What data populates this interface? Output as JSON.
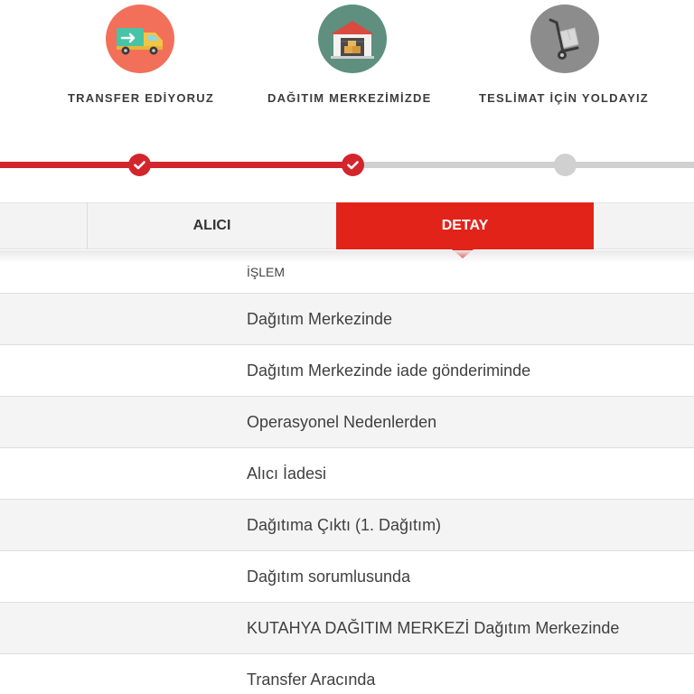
{
  "steps": [
    {
      "label": "TRANSFER EDİYORUZ",
      "icon": "truck-icon",
      "color": "#f2705a",
      "status": "done"
    },
    {
      "label": "DAĞITIM MERKEZİMİZDE",
      "icon": "warehouse-icon",
      "color": "#5e8f7f",
      "status": "done"
    },
    {
      "label": "TESLİMAT İÇİN YOLDAYIZ",
      "icon": "hand-truck-icon",
      "color": "#8c8c8c",
      "status": "pending"
    }
  ],
  "progress": {
    "completed_steps": 2,
    "total_steps": 3,
    "done_color": "#d3252c",
    "pending_color": "#d0d0d0"
  },
  "tabs": {
    "alici": "ALICI",
    "detay": "DETAY",
    "active": "DETAY",
    "active_color": "#e2231a"
  },
  "table": {
    "header": "İŞLEM",
    "rows": [
      "Dağıtım Merkezinde",
      "Dağıtım Merkezinde iade gönderiminde",
      "Operasyonel Nedenlerden",
      "Alıcı İadesi",
      "Dağıtıma Çıktı (1. Dağıtım)",
      "Dağıtım sorumlusunda",
      "KUTAHYA DAĞITIM MERKEZİ Dağıtım Merkezinde",
      "Transfer Aracında"
    ]
  }
}
